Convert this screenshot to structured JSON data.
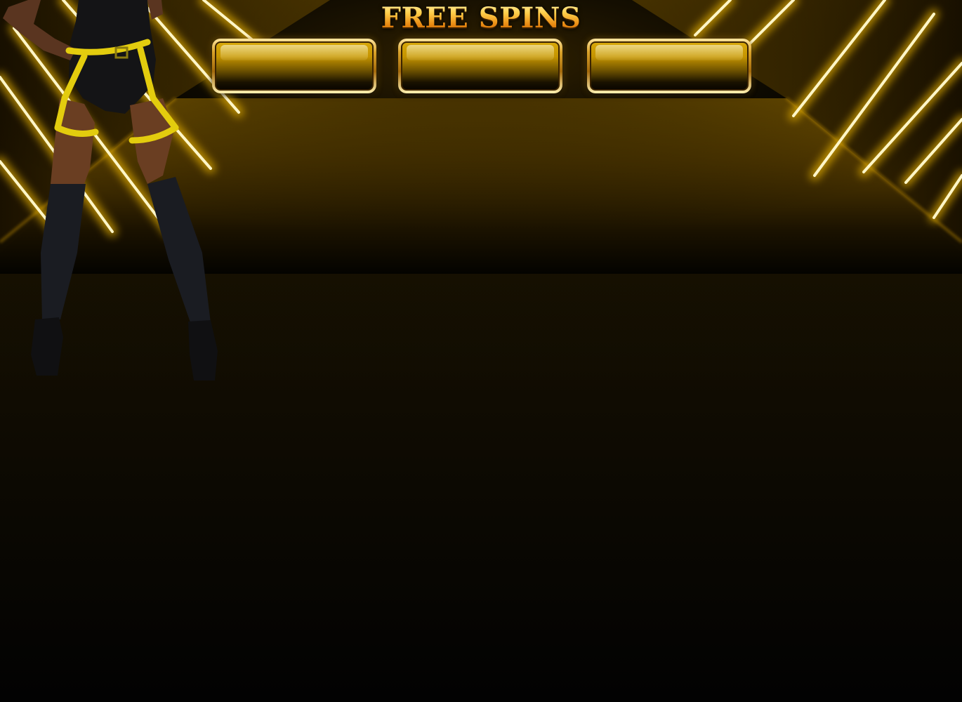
{
  "game": {
    "title": "FREE SPINS"
  },
  "counters": [
    {
      "id": "left",
      "value": ""
    },
    {
      "id": "center",
      "value": ""
    },
    {
      "id": "right",
      "value": ""
    }
  ],
  "colors": {
    "accent_gold": "#f5b21f",
    "neon_yellow": "#ffd200",
    "background": "#020202",
    "harness_yellow": "#e8d010"
  }
}
